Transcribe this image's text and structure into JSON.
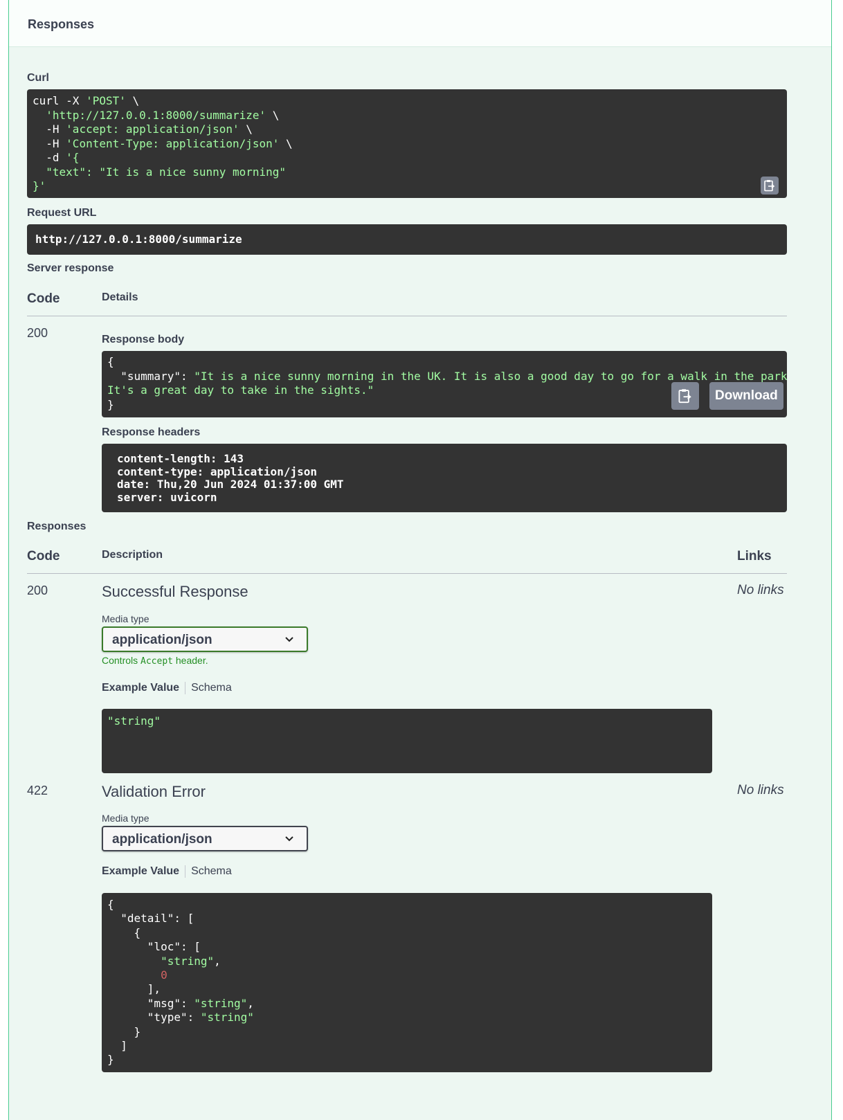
{
  "section": {
    "title": "Responses"
  },
  "curl": {
    "label": "Curl",
    "line1_cmd": "curl -X ",
    "line1_method": "'POST'",
    "line1_tail": " \\",
    "line2_url": "'http://127.0.0.1:8000/summarize'",
    "line2_tail": " \\",
    "line3_flag": "-H ",
    "line3_val": "'accept: application/json'",
    "line3_tail": " \\",
    "line4_flag": "-H ",
    "line4_val": "'Content-Type: application/json'",
    "line4_tail": " \\",
    "line5_flag": "-d ",
    "line5_val": "'{",
    "line6": "\"text\": \"It is a nice sunny morning\"",
    "line7": "}'",
    "copy_icon": "copy-to-clipboard-icon"
  },
  "request_url": {
    "label": "Request URL",
    "value": "http://127.0.0.1:8000/summarize"
  },
  "server_response": {
    "label": "Server response",
    "col_code": "Code",
    "col_details": "Details",
    "code": "200",
    "body_label": "Response body",
    "body_line1": "{",
    "body_key": "\"summary\"",
    "body_colon": ": ",
    "body_val1": "\"It is a nice sunny morning in the UK. It is also a good day to go for a walk in the park.",
    "body_val2": "It's a great day to take in the sights.\"",
    "body_line4": "}",
    "download_label": "Download",
    "headers_label": "Response headers",
    "headers": [
      "content-length: 143",
      "content-type: application/json",
      "date: Thu,20 Jun 2024 01:37:00 GMT",
      "server: uvicorn"
    ]
  },
  "responses": {
    "label": "Responses",
    "col_code": "Code",
    "col_description": "Description",
    "col_links": "Links",
    "items": [
      {
        "code": "200",
        "description": "Successful Response",
        "links": "No links",
        "media_label": "Media type",
        "media_value": "application/json",
        "hint_pre": "Controls ",
        "hint_code": "Accept",
        "hint_post": " header.",
        "tab_example": "Example Value",
        "tab_schema": "Schema",
        "example": "\"string\""
      },
      {
        "code": "422",
        "description": "Validation Error",
        "links": "No links",
        "media_label": "Media type",
        "media_value": "application/json",
        "tab_example": "Example Value",
        "tab_schema": "Schema",
        "ex_l1": "{",
        "ex_l2_key": "\"detail\"",
        "ex_l2_tail": ": [",
        "ex_l3": "{",
        "ex_l4_key": "\"loc\"",
        "ex_l4_tail": ": [",
        "ex_l5": "\"string\"",
        "ex_l5_tail": ",",
        "ex_l6": "0",
        "ex_l7": "],",
        "ex_l8_key": "\"msg\"",
        "ex_l8_mid": ": ",
        "ex_l8_val": "\"string\"",
        "ex_l8_tail": ",",
        "ex_l9_key": "\"type\"",
        "ex_l9_mid": ": ",
        "ex_l9_val": "\"string\"",
        "ex_l10": "}",
        "ex_l11": "]",
        "ex_l12": "}"
      }
    ]
  },
  "colors": {
    "panel_bg": "#edf7f2",
    "panel_border": "#49cc90",
    "code_bg": "#333333",
    "string_green": "#a2fca2",
    "number_red": "#d36363",
    "hint_green": "#248f24",
    "button_gray": "#7d8492"
  }
}
